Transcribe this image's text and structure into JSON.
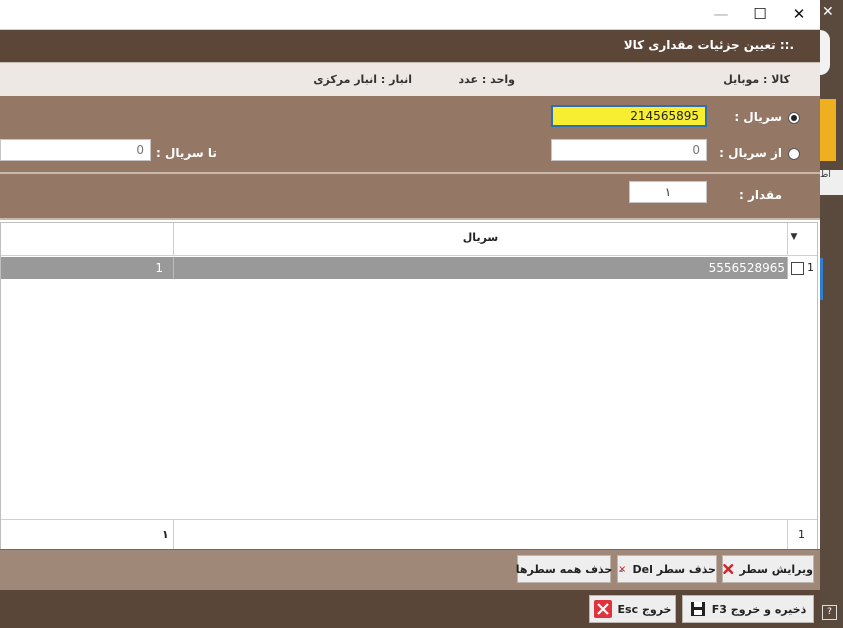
{
  "window": {
    "minimize_glyph": "—",
    "maximize_glyph": "☐",
    "close_glyph": "✕",
    "title": ".:: تعیین جزئیات مقداری کالا"
  },
  "info": {
    "item": "کالا : موبایل",
    "unit": "واحد : عدد",
    "warehouse": "انبار : انبار مرکزی"
  },
  "serial_section": {
    "serial_label": "سریال :",
    "serial_value": "214565895",
    "from_label": "از سریال :",
    "from_value": "0",
    "to_label": "تا سریال :",
    "to_value": "0"
  },
  "quantity_section": {
    "label": "مقدار :",
    "value": "۱"
  },
  "grid": {
    "column_serial": "سریال",
    "filter_glyph": "▼",
    "rows": [
      {
        "row_number": "1",
        "serial": "5556528965",
        "qty": "1"
      }
    ],
    "footer_count": "1",
    "footer_total": "۱"
  },
  "actions": {
    "edit_row": "ویرایش سطر",
    "delete_row": "حذف سطر Del",
    "delete_all_rows": "حذف همه سطرها"
  },
  "footer": {
    "save_exit": "ذخیره و خروج F3",
    "exit": "خروج Esc"
  },
  "side_strip": {
    "close_glyph": "✕",
    "partial_label": "اط",
    "help_glyph": "?"
  },
  "colors": {
    "header_brown": "#5b4637",
    "panel_brown": "#947765",
    "active_field": "#f7ee32",
    "selected_row": "#999999",
    "accent_orange": "#eeb01e"
  }
}
